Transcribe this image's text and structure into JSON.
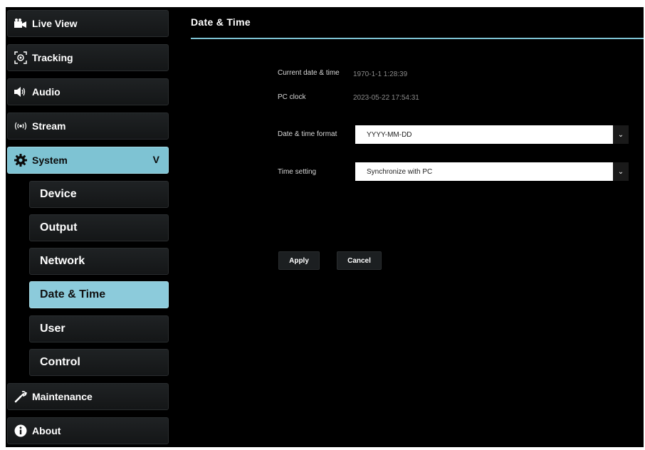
{
  "sidebar": {
    "items": [
      {
        "label": "Live View",
        "icon": "video-camera-icon"
      },
      {
        "label": "Tracking",
        "icon": "tracking-target-icon"
      },
      {
        "label": "Audio",
        "icon": "speaker-icon"
      },
      {
        "label": "Stream",
        "icon": "broadcast-icon"
      },
      {
        "label": "System",
        "icon": "gear-icon",
        "expanded_indicator": "V"
      },
      {
        "label": "Maintenance",
        "icon": "wrench-icon"
      },
      {
        "label": "About",
        "icon": "info-icon"
      }
    ],
    "system_subitems": [
      {
        "label": "Device"
      },
      {
        "label": "Output"
      },
      {
        "label": "Network"
      },
      {
        "label": "Date & Time"
      },
      {
        "label": "User"
      },
      {
        "label": "Control"
      }
    ]
  },
  "main": {
    "title": "Date & Time",
    "current_label": "Current date & time",
    "current_value": "1970-1-1 1:28:39",
    "pc_clock_label": "PC clock",
    "pc_clock_value": "2023-05-22 17:54:31",
    "format_label": "Date & time format",
    "format_value": "YYYY-MM-DD",
    "time_setting_label": "Time setting",
    "time_setting_value": "Synchronize with PC",
    "dropdown_arrow": "⌄",
    "apply_label": "Apply",
    "cancel_label": "Cancel"
  },
  "colors": {
    "accent": "#7ec3d3",
    "background": "#000000",
    "nav_bg": "#1a1c1e"
  }
}
